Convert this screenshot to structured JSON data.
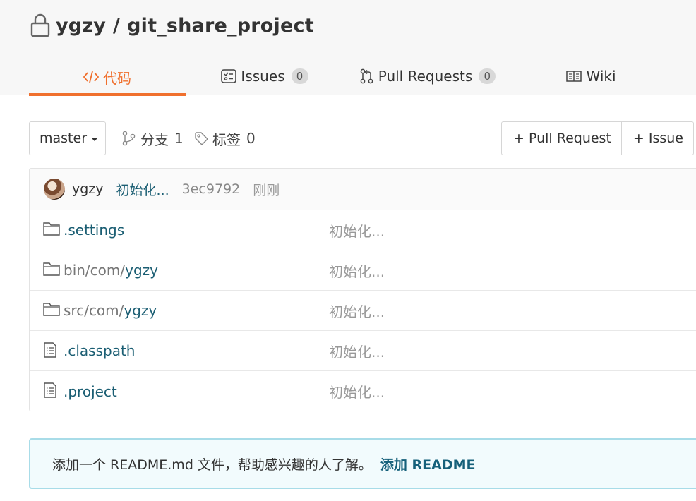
{
  "repo": {
    "owner": "ygzy",
    "separator": "/",
    "name": "git_share_project"
  },
  "tabs": [
    {
      "label": "代码",
      "icon": "code-icon",
      "active": true
    },
    {
      "label": "Issues",
      "icon": "issues-icon",
      "count": "0"
    },
    {
      "label": "Pull Requests",
      "icon": "pull-request-icon",
      "count": "0"
    },
    {
      "label": "Wiki",
      "icon": "wiki-book-icon"
    }
  ],
  "toolbar": {
    "branch": "master",
    "branches_label": "分支",
    "branches_count": "1",
    "tags_label": "标签",
    "tags_count": "0",
    "new_pr_label": "+ Pull Request",
    "new_issue_label": "+ Issue"
  },
  "latest_commit": {
    "user": "ygzy",
    "message": "初始化...",
    "hash": "3ec9792",
    "time": "刚刚"
  },
  "files": [
    {
      "type": "folder",
      "name": ".settings",
      "dim_prefix": "",
      "message": "初始化..."
    },
    {
      "type": "folder",
      "name": "ygzy",
      "dim_prefix": "bin/com/",
      "message": "初始化..."
    },
    {
      "type": "folder",
      "name": "ygzy",
      "dim_prefix": "src/com/",
      "message": "初始化..."
    },
    {
      "type": "file",
      "name": ".classpath",
      "dim_prefix": "",
      "message": "初始化..."
    },
    {
      "type": "file",
      "name": ".project",
      "dim_prefix": "",
      "message": "初始化..."
    }
  ],
  "readme": {
    "hint": "添加一个 README.md 文件，帮助感兴趣的人了解。",
    "link": "添加 README"
  },
  "colors": {
    "accent": "#f0702e",
    "link": "#1b5e73",
    "readme_border": "#a8dce8"
  }
}
